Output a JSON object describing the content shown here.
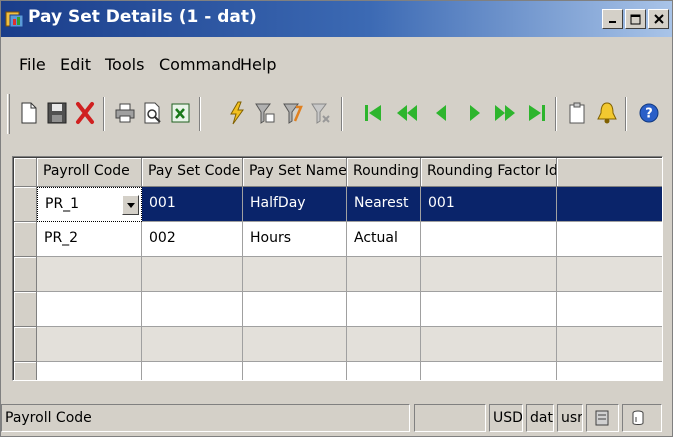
{
  "window": {
    "title": "Pay Set Details (1 - dat)",
    "icon": "app-pay-icon",
    "buttons": [
      "minimize-icon",
      "maximize-icon",
      "close-icon"
    ]
  },
  "menu": {
    "items": [
      "File",
      "Edit",
      "Tools",
      "Command",
      "Help"
    ]
  },
  "toolbar": {
    "icons": [
      "new-document-icon",
      "save-icon",
      "delete-icon",
      "print-icon",
      "print-preview-icon",
      "export-excel-icon",
      "lightning-icon",
      "filter-icon",
      "filter-apply-icon",
      "filter-clear-icon",
      "first-record-icon",
      "previous-page-icon",
      "previous-record-icon",
      "next-record-icon",
      "next-page-icon",
      "last-record-icon",
      "clipboard-icon",
      "bell-icon",
      "help-icon"
    ],
    "accent_green": "#2db52d",
    "accent_red": "#d02020"
  },
  "grid": {
    "columns": [
      "Payroll Code",
      "Pay Set Code",
      "Pay Set Name",
      "Rounding",
      "Rounding Factor Id"
    ],
    "rows": [
      {
        "payroll_code": "PR_1",
        "pay_set_code": "001",
        "pay_set_name": "HalfDay",
        "rounding": "Nearest",
        "rounding_factor_id": "001"
      },
      {
        "payroll_code": "PR_2",
        "pay_set_code": "002",
        "pay_set_name": "Hours",
        "rounding": "Actual",
        "rounding_factor_id": ""
      }
    ],
    "selected_color": "#0a246a"
  },
  "statusbar": {
    "message": "Payroll Code",
    "currency": "USD",
    "company": "dat",
    "user": "usr"
  }
}
